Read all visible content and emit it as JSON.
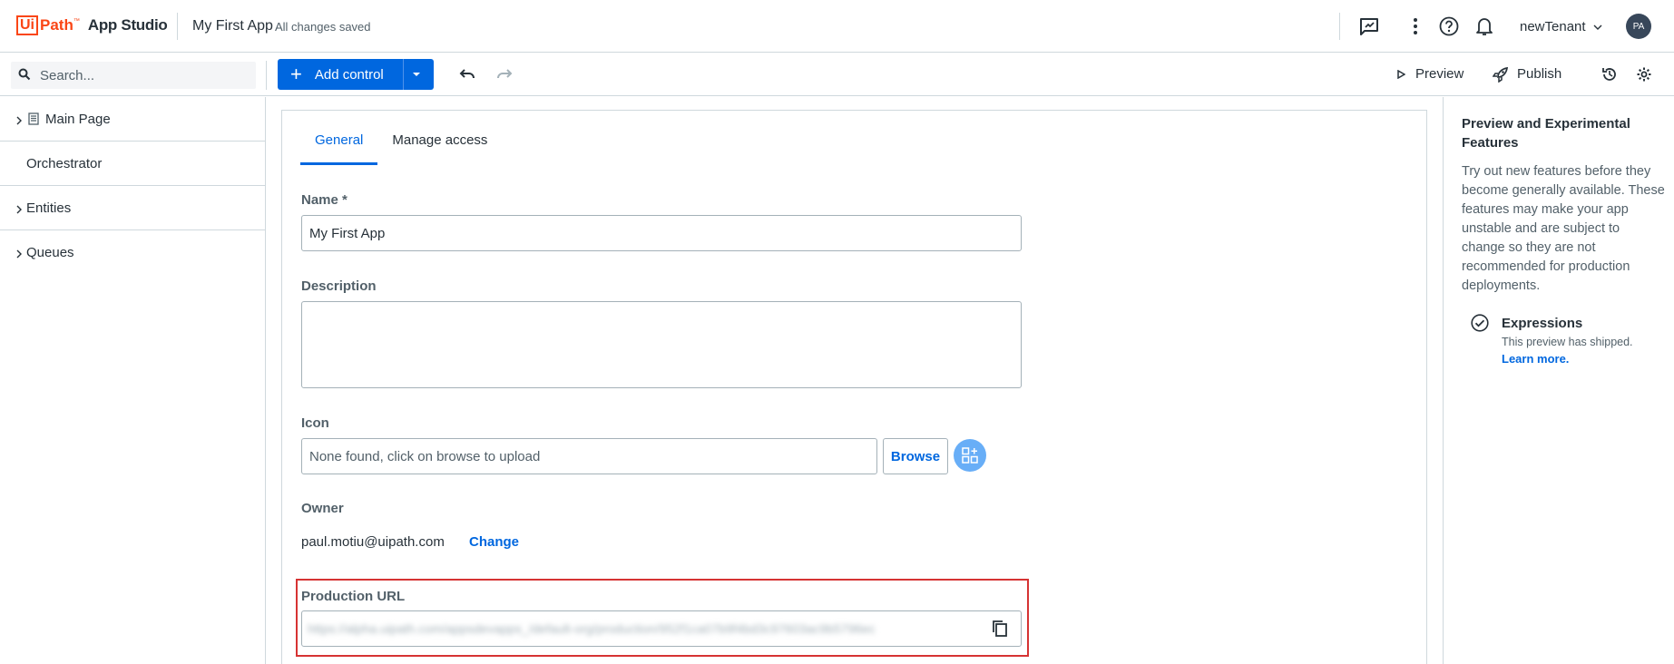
{
  "header": {
    "logo_box": "Ui",
    "logo_path": "Path",
    "logo_tm": "™",
    "product": "App Studio",
    "app_name": "My First App",
    "save_status": "All changes saved",
    "tenant": "newTenant",
    "avatar_initials": "PA"
  },
  "toolbar": {
    "search_placeholder": "Search...",
    "add_control_label": "Add control",
    "preview_label": "Preview",
    "publish_label": "Publish"
  },
  "nav": {
    "items": [
      {
        "label": "Main Page",
        "expandable": true,
        "icon": "page-icon"
      },
      {
        "label": "Orchestrator",
        "expandable": false
      },
      {
        "label": "Entities",
        "expandable": true
      },
      {
        "label": "Queues",
        "expandable": true
      }
    ]
  },
  "settings": {
    "tabs": [
      {
        "label": "General",
        "active": true
      },
      {
        "label": "Manage access",
        "active": false
      }
    ],
    "name_label": "Name *",
    "name_value": "My First App",
    "description_label": "Description",
    "description_value": "",
    "icon_label": "Icon",
    "icon_placeholder": "None found, click on browse to upload",
    "browse_label": "Browse",
    "owner_label": "Owner",
    "owner_email": "paul.motiu@uipath.com",
    "owner_change": "Change",
    "production_url_label": "Production URL",
    "production_url_value": "https://alpha.uipath.com/appsdevapps_/default-org/production/952f1ca07b9f4bd3c97603ac9b5796ec"
  },
  "right_panel": {
    "title": "Preview and Experimental Features",
    "description": "Try out new features before they become generally available. These features may make your app unstable and are subject to change so they are not recommended for production deployments.",
    "feature_name": "Expressions",
    "feature_status": "This preview has shipped.",
    "learn_more": "Learn more."
  },
  "colors": {
    "brand_orange": "#fa4616",
    "primary_blue": "#0067df",
    "highlight_red": "#d63333"
  }
}
